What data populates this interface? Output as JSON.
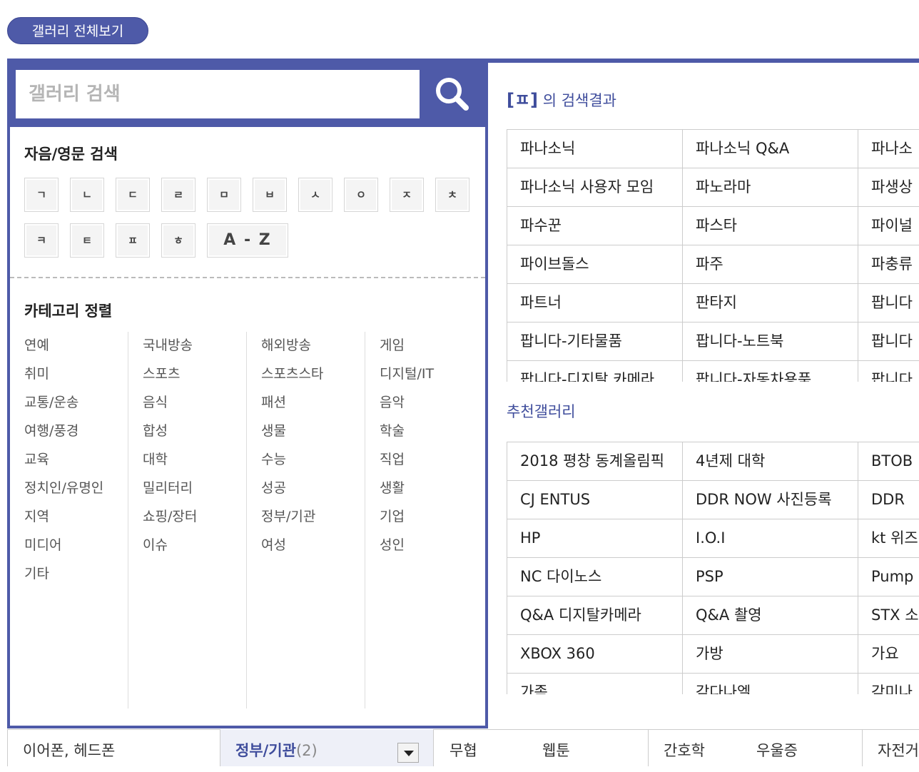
{
  "header": {
    "gallery_all_label": "갤러리 전체보기"
  },
  "search": {
    "placeholder": "갤러리 검색"
  },
  "initials": {
    "title": "자음/영문 검색",
    "row1": [
      "ㄱ",
      "ㄴ",
      "ㄷ",
      "ㄹ",
      "ㅁ",
      "ㅂ",
      "ㅅ",
      "ㅇ",
      "ㅈ",
      "ㅊ"
    ],
    "row2": [
      "ㅋ",
      "ㅌ",
      "ㅍ",
      "ㅎ"
    ],
    "az_label": "A - Z"
  },
  "categories": {
    "title": "카테고리 정렬",
    "columns": [
      [
        "연예",
        "취미",
        "교통/운송",
        "여행/풍경",
        "교육",
        "정치인/유명인",
        "지역",
        "미디어",
        "기타"
      ],
      [
        "국내방송",
        "스포츠",
        "음식",
        "합성",
        "대학",
        "밀리터리",
        "쇼핑/장터",
        "이슈"
      ],
      [
        "해외방송",
        "스포츠스타",
        "패션",
        "생물",
        "수능",
        "성공",
        "정부/기관",
        "여성"
      ],
      [
        "게임",
        "디지털/IT",
        "음악",
        "학술",
        "직업",
        "생활",
        "기업",
        "성인"
      ]
    ]
  },
  "results": {
    "bracket_text": "[ㅍ]",
    "title_suffix": " 의 검색결과",
    "rows": [
      [
        "파나소닉",
        "파나소닉 Q&A",
        "파나소"
      ],
      [
        "파나소닉 사용자 모임",
        "파노라마",
        "파생상"
      ],
      [
        "파수꾼",
        "파스타",
        "파이널"
      ],
      [
        "파이브돌스",
        "파주",
        "파충류"
      ],
      [
        "파트너",
        "판타지",
        "팝니다"
      ],
      [
        "팝니다-기타물품",
        "팝니다-노트북",
        "팝니다"
      ],
      [
        "팝니다-디지탈 카메라",
        "팝니다-자동차용품",
        "팝니다"
      ]
    ]
  },
  "recommended": {
    "title": "추천갤러리",
    "rows": [
      [
        "2018 평창 동계올림픽",
        "4년제 대학",
        "BTOB"
      ],
      [
        "CJ ENTUS",
        "DDR NOW 사진등록",
        "DDR"
      ],
      [
        "HP",
        "I.O.I",
        "kt 위즈"
      ],
      [
        "NC 다이노스",
        "PSP",
        "Pump"
      ],
      [
        "Q&A 디지탈카메라",
        "Q&A 촬영",
        "STX 소"
      ],
      [
        "XBOX 360",
        "가방",
        "가요"
      ],
      [
        "가족",
        "감다나엘",
        "감미나"
      ]
    ]
  },
  "bottom": {
    "item1": "이어폰, 헤드폰",
    "selected_label": "정부/기관",
    "selected_count": "(2)",
    "item3": "무협",
    "item4": "웹툰",
    "item5": "간호학",
    "item6": "우울증",
    "item7": "자전거"
  },
  "colors": {
    "accent": "#4e5aa8",
    "link": "#3f4d9c"
  }
}
